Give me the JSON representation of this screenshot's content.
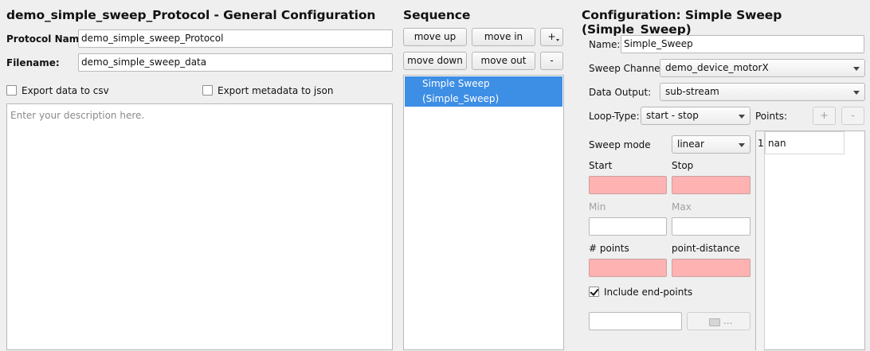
{
  "general": {
    "title": "demo_simple_sweep_Protocol - General Configuration",
    "protocol_name_label": "Protocol Name:",
    "protocol_name_value": "demo_simple_sweep_Protocol",
    "filename_label": "Filename:",
    "filename_value": "demo_simple_sweep_data",
    "export_csv_label": "Export data to csv",
    "export_json_label": "Export metadata to json",
    "description_placeholder": "Enter your description here."
  },
  "sequence": {
    "title": "Sequence",
    "move_up": "move up",
    "move_in": "move in",
    "add": "+",
    "move_down": "move down",
    "move_out": "move out",
    "remove": "-",
    "items": [
      "Simple Sweep (Simple_Sweep)"
    ]
  },
  "config": {
    "title": "Configuration: Simple Sweep (Simple_Sweep)",
    "name_label": "Name:",
    "name_value": "Simple_Sweep",
    "sweep_channel_label": "Sweep Channel:",
    "sweep_channel_value": "demo_device_motorX",
    "data_output_label": "Data Output:",
    "data_output_value": "sub-stream",
    "loop_type_label": "Loop-Type:",
    "loop_type_value": "start - stop",
    "points_label": "Points:",
    "points_add": "+",
    "points_remove": "-",
    "points_table": [
      {
        "index": "1",
        "value": "nan"
      }
    ],
    "sweep_mode_label": "Sweep mode",
    "sweep_mode_value": "linear",
    "start_label": "Start",
    "stop_label": "Stop",
    "min_label": "Min",
    "max_label": "Max",
    "num_points_label": "# points",
    "point_distance_label": "point-distance",
    "include_endpoints_label": "Include end-points",
    "include_endpoints_checked": true,
    "file_button_label": "...",
    "colors": {
      "invalid_field": "#ffb2b2",
      "selection": "#3d8ee5"
    }
  }
}
